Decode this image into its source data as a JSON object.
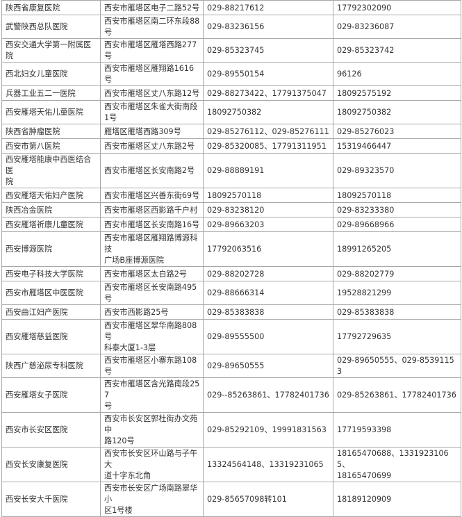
{
  "rows": [
    {
      "name": [
        "陕西省康复医院"
      ],
      "address": [
        "西安市雁塔区电子二路52号"
      ],
      "phone": [
        "029-88217612"
      ],
      "contact": [
        "17792302090"
      ]
    },
    {
      "name": [
        "武警陕西总队医院"
      ],
      "address": [
        "西安市雁塔区南二环东段88号"
      ],
      "phone": [
        "029-83236156"
      ],
      "contact": [
        "029-83236087"
      ]
    },
    {
      "name": [
        "西安交通大学第一附属医院"
      ],
      "address": [
        "西安市雁塔区雁塔西路277号"
      ],
      "phone": [
        "029-85323745"
      ],
      "contact": [
        "029-85323742"
      ]
    },
    {
      "name": [
        "西北妇女儿童医院"
      ],
      "address": [
        "西安市雁塔区雁翔路1616号"
      ],
      "phone": [
        "029-89550154"
      ],
      "contact": [
        "96126"
      ]
    },
    {
      "name": [
        "兵器工业五二一医院"
      ],
      "address": [
        "西安市雁塔区丈八东路12号"
      ],
      "phone": [
        "029-88273422、17791375047"
      ],
      "contact": [
        "18092575192"
      ]
    },
    {
      "name": [
        "西安雁塔天佑儿童医院"
      ],
      "address": [
        "西安市雁塔区朱雀大街南段1号"
      ],
      "phone": [
        "18092750382"
      ],
      "contact": [
        "18092750382"
      ]
    },
    {
      "name": [
        "陕西省肿瘤医院"
      ],
      "address": [
        "雁塔区雁塔西路309号"
      ],
      "phone": [
        "029-85276112、029-85276111"
      ],
      "contact": [
        "029-85276023"
      ]
    },
    {
      "name": [
        "西安市第八医院"
      ],
      "address": [
        "西安市雁塔区丈八东路2号"
      ],
      "phone": [
        "029-85320085、17791311951"
      ],
      "contact": [
        "15319466447"
      ]
    },
    {
      "name": [
        "西安雁塔能康中西医结合医",
        "院"
      ],
      "address": [
        "西安市雁塔区长安南路2号"
      ],
      "phone": [
        "029-88889191"
      ],
      "contact": [
        "029-89323570"
      ]
    },
    {
      "name": [
        "西安雁塔天佑妇产医院"
      ],
      "address": [
        "西安市雁塔区兴善东街69号"
      ],
      "phone": [
        "18092570118"
      ],
      "contact": [
        "18092570118"
      ]
    },
    {
      "name": [
        "陕西冶金医院"
      ],
      "address": [
        "西安市雁塔区西影路千户村"
      ],
      "phone": [
        "029-83238120"
      ],
      "contact": [
        "029-83233380"
      ]
    },
    {
      "name": [
        "西安雁塔祈康儿童医院"
      ],
      "address": [
        "西安市雁塔区长安南路16号"
      ],
      "phone": [
        "029-89663203"
      ],
      "contact": [
        "029-89668966"
      ]
    },
    {
      "name": [
        "西安博源医院"
      ],
      "address": [
        "西安市雁塔区雁翔路博源科技",
        "广场B座博源医院"
      ],
      "phone": [
        "17792063516"
      ],
      "contact": [
        "18991265205"
      ]
    },
    {
      "name": [
        "西安电子科技大学医院"
      ],
      "address": [
        "西安市雁塔区太白路2号"
      ],
      "phone": [
        "029-88202728"
      ],
      "contact": [
        "029-88202779"
      ]
    },
    {
      "name": [
        "西安市雁塔区中医医院"
      ],
      "address": [
        "西安市雁塔区长安南路495号"
      ],
      "phone": [
        "029-88666314"
      ],
      "contact": [
        "19528821299"
      ]
    },
    {
      "name": [
        "西安曲江妇产医院"
      ],
      "address": [
        "西安市西影路25号"
      ],
      "phone": [
        "029-85383838"
      ],
      "contact": [
        "029-85383838"
      ]
    },
    {
      "name": [
        "西安雁塔慈益医院"
      ],
      "address": [
        "西安市雁塔区翠华南路808号",
        "科泰大厦1-3层"
      ],
      "phone": [
        "029-89555500"
      ],
      "contact": [
        "17792729635"
      ]
    },
    {
      "name": [
        "陕西广慈泌尿专科医院"
      ],
      "address": [
        "西安市雁塔区小寨东路108号"
      ],
      "phone": [
        "029-89650555"
      ],
      "contact": [
        "029-89650555、029-85391153"
      ]
    },
    {
      "name": [
        "西安雁塔女子医院"
      ],
      "address": [
        "西安市雁塔区含光路南段257",
        "号"
      ],
      "phone": [
        "029--85263861、17782401736"
      ],
      "contact": [
        "029-85263861、17782401736"
      ]
    },
    {
      "name": [
        "西安市长安区医院"
      ],
      "address": [
        "西安市长安区郭杜街办文苑中",
        "路120号"
      ],
      "phone": [
        "029-85292109、19991831563"
      ],
      "contact": [
        "17719593398"
      ]
    },
    {
      "name": [
        "西安长安康复医院"
      ],
      "address": [
        "西安市长安区环山路与子午大",
        "道十字东北角"
      ],
      "phone": [
        "13324564148、13319231065"
      ],
      "contact": [
        "18165470688、13319231065、",
        "18165470699"
      ]
    },
    {
      "name": [
        "西安长安大千医院"
      ],
      "address": [
        "西安市长安区广场南路翠华小",
        "区1号楼"
      ],
      "phone": [
        "029-85657098转101"
      ],
      "contact": [
        "18189120909"
      ]
    }
  ]
}
